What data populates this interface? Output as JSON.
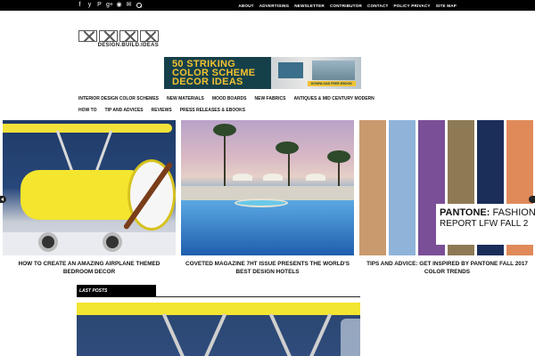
{
  "social_icons": [
    "facebook-icon",
    "twitter-icon",
    "pinterest-icon",
    "google-plus-icon",
    "rss-icon",
    "email-icon",
    "search-icon"
  ],
  "social_glyphs": [
    "f",
    "y",
    "P",
    "g+",
    "◉",
    "✉"
  ],
  "topnav": [
    "ABOUT",
    "ADVERTISING",
    "NEWSLETTER",
    "CONTRIBUTOR",
    "CONTACT",
    "POLICY PRIVACY",
    "SITE MAP"
  ],
  "logo": {
    "text": "DESIGN.BUILD.IDEAS"
  },
  "banner": {
    "line1": "50 STRIKING",
    "line2": "COLOR SCHEME",
    "line3": "DECOR IDEAS",
    "button": "DOWNLOAD FREE EBOOK",
    "accent": "#f2c230",
    "background": "#15404a"
  },
  "mainnav": {
    "row1": [
      "INTERIOR DESIGN COLOR SCHEMES",
      "NEW MATERIALS",
      "MOOD BOARDS",
      "NEW FABRICS",
      "ANTIQUES & MID CENTURY MODERN"
    ],
    "row2": [
      "HOW TO",
      "TIP AND ADVICES",
      "REVIEWS",
      "PRESS RELEASES & EBOOKS"
    ]
  },
  "slides": [
    {
      "caption": "HOW TO CREATE AN AMAZING AIRPLANE THEMED BEDROOM DECOR"
    },
    {
      "caption": "COVETED MAGAZINE 7HT ISSUE PRESENTS THE WORLD'S BEST DESIGN HOTELS"
    },
    {
      "caption": "TIPS AND ADVICE: GET INSPIRED BY PANTONE FALL 2017 COLOR TRENDS",
      "overlay_brand": "PANTONE:",
      "overlay_title": " FASHION",
      "overlay_sub": "REPORT LFW FALL 2",
      "swatches": [
        "#c99a6e",
        "#8fb3d9",
        "#7b4f97",
        "#8d7a55",
        "#1b2e5a",
        "#e08a5a"
      ]
    }
  ],
  "last_posts": {
    "label": "LAST POSTS"
  }
}
